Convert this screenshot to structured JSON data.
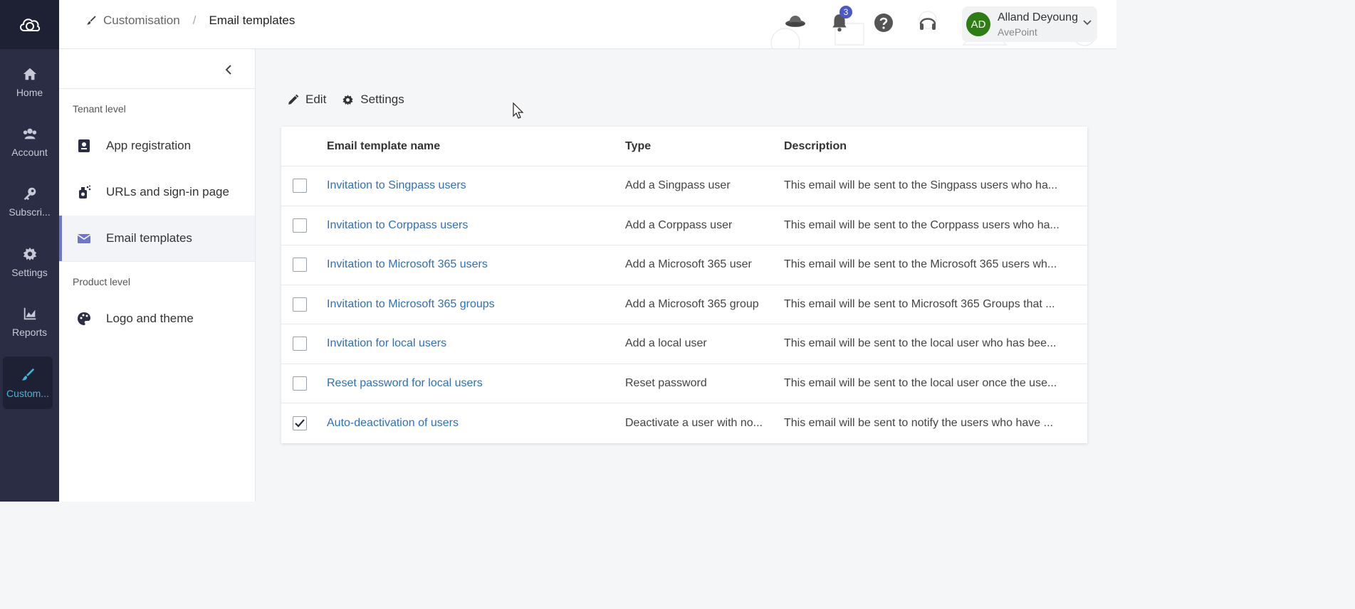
{
  "rail": {
    "items": [
      {
        "label": "Home",
        "icon": "home-icon"
      },
      {
        "label": "Account",
        "icon": "users-icon"
      },
      {
        "label": "Subscri...",
        "icon": "key-icon"
      },
      {
        "label": "Settings",
        "icon": "gear-icon"
      },
      {
        "label": "Reports",
        "icon": "chart-icon"
      },
      {
        "label": "Custom...",
        "icon": "brush-icon",
        "active": true
      }
    ]
  },
  "header": {
    "breadcrumb_parent": "Customisation",
    "breadcrumb_separator": "/",
    "breadcrumb_current": "Email templates",
    "notification_count": "3",
    "user_initials": "AD",
    "user_name": "Alland Deyoung",
    "user_org": "AvePoint"
  },
  "sidebar": {
    "section_tenant": "Tenant level",
    "section_product": "Product level",
    "items": [
      {
        "label": "App registration",
        "icon": "app-registration-icon"
      },
      {
        "label": "URLs and sign-in page",
        "icon": "url-icon"
      },
      {
        "label": "Email templates",
        "icon": "envelope-icon",
        "active": true
      },
      {
        "label": "Logo and theme",
        "icon": "palette-icon"
      }
    ]
  },
  "toolbar": {
    "edit_label": "Edit",
    "settings_label": "Settings"
  },
  "table": {
    "columns": [
      "Email template name",
      "Type",
      "Description"
    ],
    "rows": [
      {
        "name": "Invitation to Singpass users",
        "type": "Add a Singpass user",
        "description": "This email will be sent to the Singpass users who ha...",
        "checked": false
      },
      {
        "name": "Invitation to Corppass users",
        "type": "Add a Corppass user",
        "description": "This email will be sent to the Corppass users who ha...",
        "checked": false
      },
      {
        "name": "Invitation to Microsoft 365 users",
        "type": "Add a Microsoft 365 user",
        "description": "This email will be sent to the Microsoft 365 users wh...",
        "checked": false
      },
      {
        "name": "Invitation to Microsoft 365 groups",
        "type": "Add a Microsoft 365 group",
        "description": "This email will be sent to Microsoft 365 Groups that ...",
        "checked": false
      },
      {
        "name": "Invitation for local users",
        "type": "Add a local user",
        "description": "This email will be sent to the local user who has bee...",
        "checked": false
      },
      {
        "name": "Reset password for local users",
        "type": "Reset password",
        "description": "This email will be sent to the local user once the use...",
        "checked": false
      },
      {
        "name": "Auto-deactivation of users",
        "type": "Deactivate a user with no...",
        "description": "This email will be sent to notify the users who have ...",
        "checked": true
      }
    ]
  },
  "colors": {
    "rail_bg": "#2b2d45",
    "accent": "#3fb7d9",
    "link": "#2d6fc1",
    "avatar": "#2e7d14",
    "badge": "#4a58c8"
  }
}
